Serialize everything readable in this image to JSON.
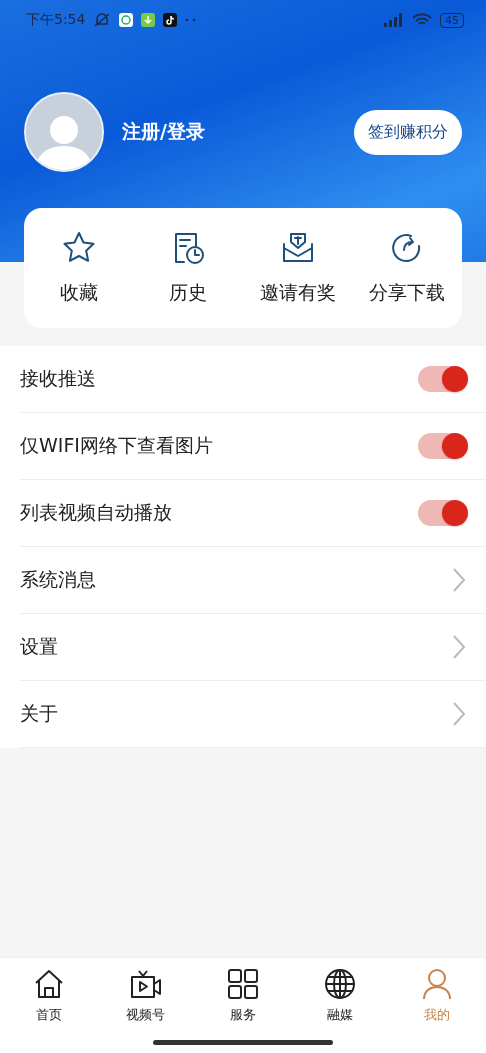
{
  "status_bar": {
    "time": "下午5:54",
    "battery": "45"
  },
  "profile": {
    "login": "注册/登录",
    "checkin_button": "签到赚积分"
  },
  "shortcuts": [
    {
      "kind": "star",
      "label": "收藏"
    },
    {
      "kind": "history",
      "label": "历史"
    },
    {
      "kind": "invite",
      "label": "邀请有奖"
    },
    {
      "kind": "share",
      "label": "分享下载"
    }
  ],
  "settings": [
    {
      "kind": "toggle",
      "label": "接收推送",
      "on": true
    },
    {
      "kind": "toggle",
      "label": "仅WIFI网络下查看图片",
      "on": true
    },
    {
      "kind": "toggle",
      "label": "列表视频自动播放",
      "on": true
    },
    {
      "kind": "link",
      "label": "系统消息"
    },
    {
      "kind": "link",
      "label": "设置"
    },
    {
      "kind": "link",
      "label": "关于"
    }
  ],
  "tabs": [
    {
      "kind": "home",
      "label": "首页",
      "selected": false
    },
    {
      "kind": "video",
      "label": "视频号",
      "selected": false
    },
    {
      "kind": "grid",
      "label": "服务",
      "selected": false
    },
    {
      "kind": "globe",
      "label": "融媒",
      "selected": false
    },
    {
      "kind": "user",
      "label": "我的",
      "selected": true
    }
  ]
}
